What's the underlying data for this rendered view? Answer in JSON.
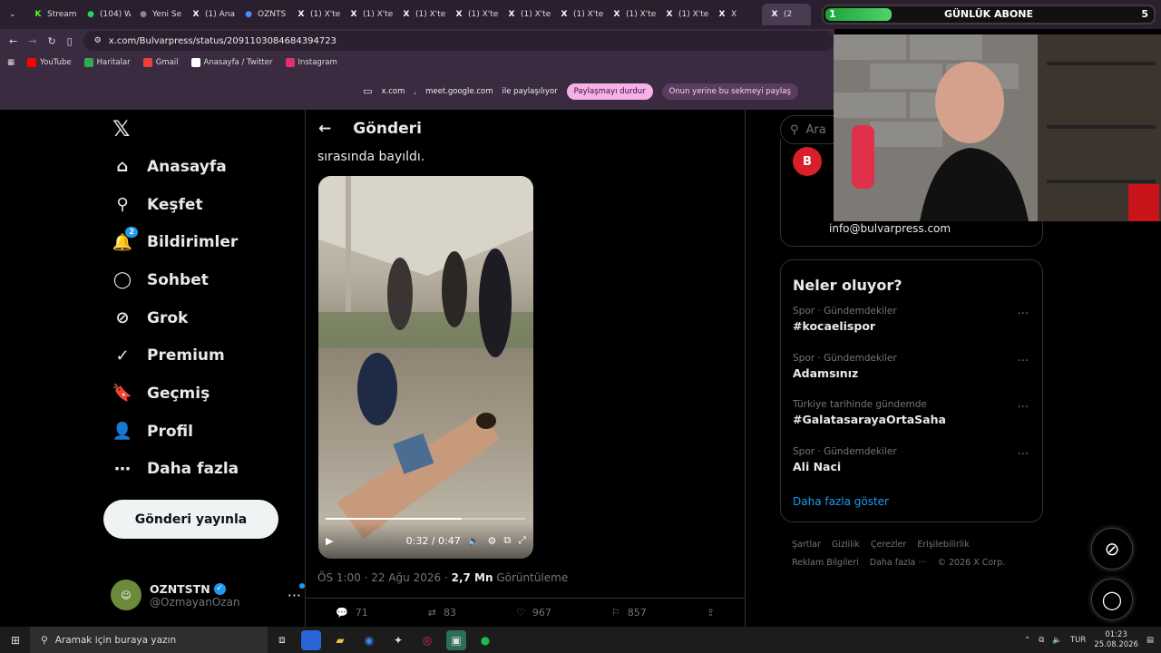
{
  "browser": {
    "tabs": [
      {
        "label": "Stream",
        "icon": "kick-icon",
        "color": "#53fc18"
      },
      {
        "label": "(104) W",
        "icon": "whatsapp-icon",
        "color": "#25d366"
      },
      {
        "label": "Yeni Se",
        "icon": "chrome-settings-icon",
        "color": "#888888"
      },
      {
        "label": "(1) Ana",
        "icon": "x-icon",
        "color": "#ffffff"
      },
      {
        "label": "OZNTS",
        "icon": "globe-icon",
        "color": "#4a8cff"
      },
      {
        "label": "(1) X'te",
        "icon": "x-icon",
        "color": "#ffffff"
      },
      {
        "label": "(1) X'te",
        "icon": "x-icon",
        "color": "#ffffff"
      },
      {
        "label": "(1) X'te",
        "icon": "x-icon",
        "color": "#ffffff"
      },
      {
        "label": "(1) X'te",
        "icon": "x-icon",
        "color": "#ffffff"
      },
      {
        "label": "(1) X'te",
        "icon": "x-icon",
        "color": "#ffffff"
      },
      {
        "label": "(1) X'te",
        "icon": "x-icon",
        "color": "#ffffff"
      },
      {
        "label": "(1) X'te",
        "icon": "x-icon",
        "color": "#ffffff"
      },
      {
        "label": "(1) X'te",
        "icon": "x-icon",
        "color": "#ffffff"
      },
      {
        "label": "X",
        "icon": "x-icon",
        "color": "#ffffff"
      },
      {
        "label": "(2",
        "icon": "x-icon",
        "color": "#ffffff"
      }
    ],
    "url": "x.com/Bulvarpress/status/2091103084684394723",
    "bookmarks": [
      {
        "label": "YouTube",
        "color": "#ff0000"
      },
      {
        "label": "Haritalar",
        "color": "#34a853"
      },
      {
        "label": "Gmail",
        "color": "#ea4335"
      },
      {
        "label": "Anasayfa / Twitter",
        "color": "#ffffff"
      },
      {
        "label": "Instagram",
        "color": "#e1306c"
      }
    ],
    "share": {
      "site1": "x.com",
      "sep": ",",
      "site2": "meet.google.com",
      "text": "ile paylaşılıyor",
      "stop": "Paylaşmayı durdur",
      "switch": "Onun yerine bu sekmeyi paylaş"
    }
  },
  "overlay": {
    "sub_left": "1",
    "sub_label": "GÜNLÜK ABONE",
    "sub_right": "5",
    "sub_progress": 0.2
  },
  "nav": {
    "items": [
      {
        "label": "Anasayfa",
        "icon": "home-icon",
        "glyph": "⌂"
      },
      {
        "label": "Keşfet",
        "icon": "search-icon",
        "glyph": "⚲"
      },
      {
        "label": "Bildirimler",
        "icon": "bell-icon",
        "glyph": "🔔"
      },
      {
        "label": "Sohbet",
        "icon": "chat-icon",
        "glyph": "◯"
      },
      {
        "label": "Grok",
        "icon": "grok-icon",
        "glyph": "⊘"
      },
      {
        "label": "Premium",
        "icon": "verified-icon",
        "glyph": "✓"
      },
      {
        "label": "Geçmiş",
        "icon": "bookmark-icon",
        "glyph": "🔖"
      },
      {
        "label": "Profil",
        "icon": "person-icon",
        "glyph": "👤"
      },
      {
        "label": "Daha fazla",
        "icon": "more-circle-icon",
        "glyph": "⋯"
      }
    ],
    "notif_badge": "2",
    "post_button": "Gönderi yayınla",
    "account_name": "OZNTSTN",
    "account_handle": "@OzmayanOzan"
  },
  "main": {
    "title": "Gönderi",
    "tweet_text": "sırasında bayıldı.",
    "video_time": "0:32 / 0:47",
    "video_progress": 0.68,
    "meta_time": "ÖS 1:00 · 22 Ağu 2026 · ",
    "views": "2,7 Mn",
    "views_label": " Görüntüleme",
    "replies": "71",
    "reposts": "83",
    "likes": "967",
    "bookmarks": "857"
  },
  "right": {
    "search_placeholder": "Ara",
    "profile_email": "info@bulvarpress.com",
    "trends_title": "Neler oluyor?",
    "trends": [
      {
        "category": "Spor · Gündemdekiler",
        "name": "#kocaelispor"
      },
      {
        "category": "Spor · Gündemdekiler",
        "name": "Adamsınız"
      },
      {
        "category": "Türkiye tarihinde gündemde",
        "name": "#GalatasarayaOrtaSaha"
      },
      {
        "category": "Spor · Gündemdekiler",
        "name": "Ali Naci"
      }
    ],
    "show_more": "Daha fazla göster",
    "footer": [
      "Şartlar",
      "Gizlilik",
      "Çerezler",
      "Erişilebilirlik",
      "Reklam Bilgileri",
      "Daha fazla ···",
      "© 2026 X Corp."
    ]
  },
  "taskbar": {
    "search_placeholder": "Aramak için buraya yazın",
    "lang": "TUR",
    "time": "01:23",
    "date": "25.08.2026"
  }
}
